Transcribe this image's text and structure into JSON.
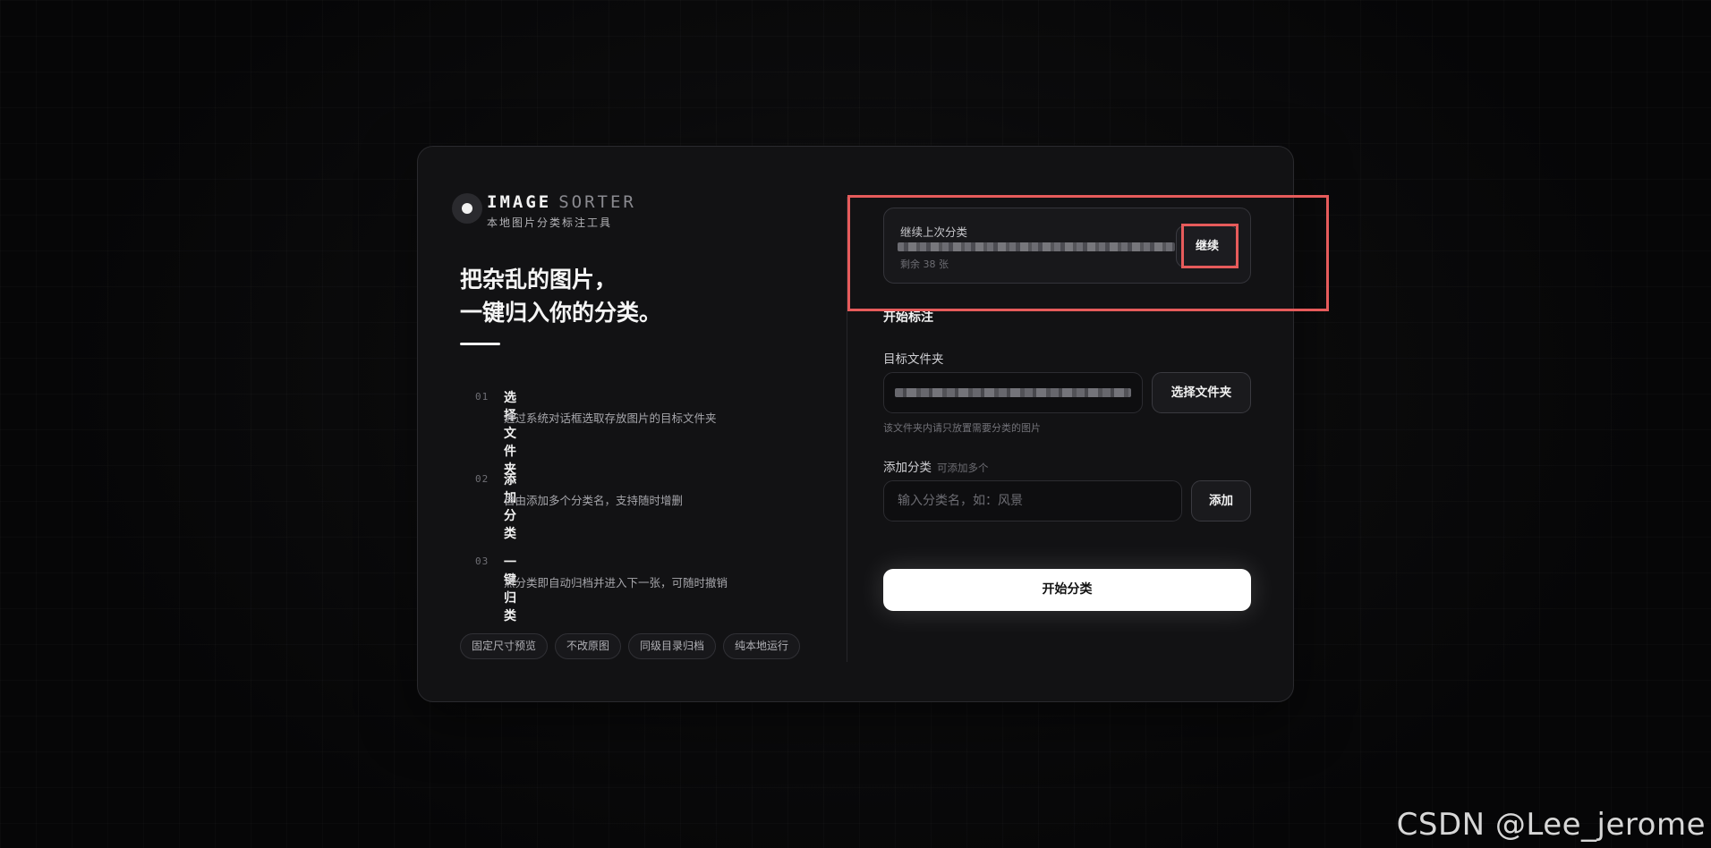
{
  "brand": {
    "title_bold": "IMAGE",
    "title_light": "SORTER",
    "subtitle": "本地图片分类标注工具"
  },
  "headline": {
    "line1": "把杂乱的图片，",
    "line2": "一键归入你的分类。"
  },
  "steps": [
    {
      "no": "01",
      "title": "选择文件夹",
      "desc": "通过系统对话框选取存放图片的目标文件夹"
    },
    {
      "no": "02",
      "title": "添加分类",
      "desc": "自由添加多个分类名，支持随时增删"
    },
    {
      "no": "03",
      "title": "一键归类",
      "desc": "点分类即自动归档并进入下一张，可随时撤销"
    }
  ],
  "tags": [
    "固定尺寸预览",
    "不改原图",
    "同级目录归档",
    "纯本地运行"
  ],
  "resume": {
    "label": "继续上次分类",
    "remaining": "剩余 38 张",
    "button": "继续"
  },
  "form": {
    "section_title": "开始标注",
    "folder_label": "目标文件夹",
    "folder_button": "选择文件夹",
    "folder_help": "该文件夹内请只放置需要分类的图片",
    "category_label": "添加分类",
    "category_hint": "可添加多个",
    "category_placeholder": "输入分类名，如：风景",
    "add_button": "添加",
    "start_button": "开始分类"
  },
  "watermark": "CSDN @Lee_jerome",
  "colors": {
    "background": "#0b0b0c",
    "card": "#121214",
    "primary_button": "#ffffff",
    "annotation": "#e65b5b"
  }
}
